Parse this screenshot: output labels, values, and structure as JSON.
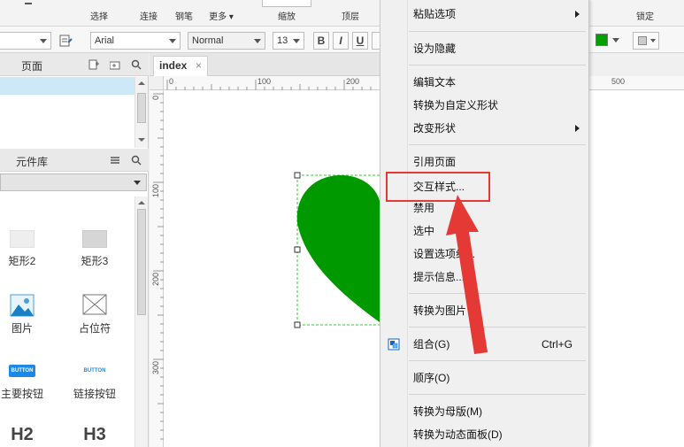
{
  "toolbar": {
    "items": [
      "选择",
      "连接",
      "钢笔",
      "更多 ▾",
      "缩放",
      "顶层",
      "锁定"
    ]
  },
  "formatbar": {
    "font_family": "Arial",
    "font_style": "Normal",
    "font_size": "13",
    "bold": "B",
    "italic": "I",
    "underline": "U",
    "fill_color": "#00a000"
  },
  "pages_panel": {
    "title": "页面"
  },
  "library_panel": {
    "title": "元件库",
    "items": [
      {
        "label": "矩形2",
        "icon": "rectangle-light-icon"
      },
      {
        "label": "矩形3",
        "icon": "rectangle-gray-icon"
      },
      {
        "label": "图片",
        "icon": "image-icon"
      },
      {
        "label": "占位符",
        "icon": "placeholder-icon"
      },
      {
        "label": "主要按钮",
        "icon": "primary-button-icon",
        "caption": "BUTTON"
      },
      {
        "label": "链接按钮",
        "icon": "link-button-icon",
        "caption": "BUTTON"
      },
      {
        "label": "H2",
        "icon": "heading2-icon"
      },
      {
        "label": "H3",
        "icon": "heading3-icon"
      }
    ]
  },
  "canvas": {
    "tab_label": "index",
    "tab_close": "×",
    "hruler_labels": [
      "0",
      "100",
      "200"
    ],
    "vruler_labels": [
      "0",
      "100",
      "200",
      "300"
    ],
    "shape_color": "#009900"
  },
  "rightstrip": {
    "ruler_label": "500",
    "toolbar_label": "锁定"
  },
  "context_menu": {
    "items": [
      {
        "label": "粘贴选项",
        "submenu": true
      },
      {
        "label": "设为隐藏"
      },
      {
        "label": "编辑文本"
      },
      {
        "label": "转换为自定义形状"
      },
      {
        "label": "改变形状",
        "submenu": true
      },
      {
        "label": "引用页面"
      },
      {
        "label": "交互样式..."
      },
      {
        "label": "禁用"
      },
      {
        "label": "选中"
      },
      {
        "label": "设置选项组..."
      },
      {
        "label": "提示信息..."
      },
      {
        "label": "转换为图片"
      },
      {
        "label": "组合(G)",
        "shortcut": "Ctrl+G"
      },
      {
        "label": "顺序(O)"
      },
      {
        "label": "转换为母版(M)"
      },
      {
        "label": "转换为动态面板(D)"
      }
    ]
  },
  "highlight_color": "#e53935"
}
